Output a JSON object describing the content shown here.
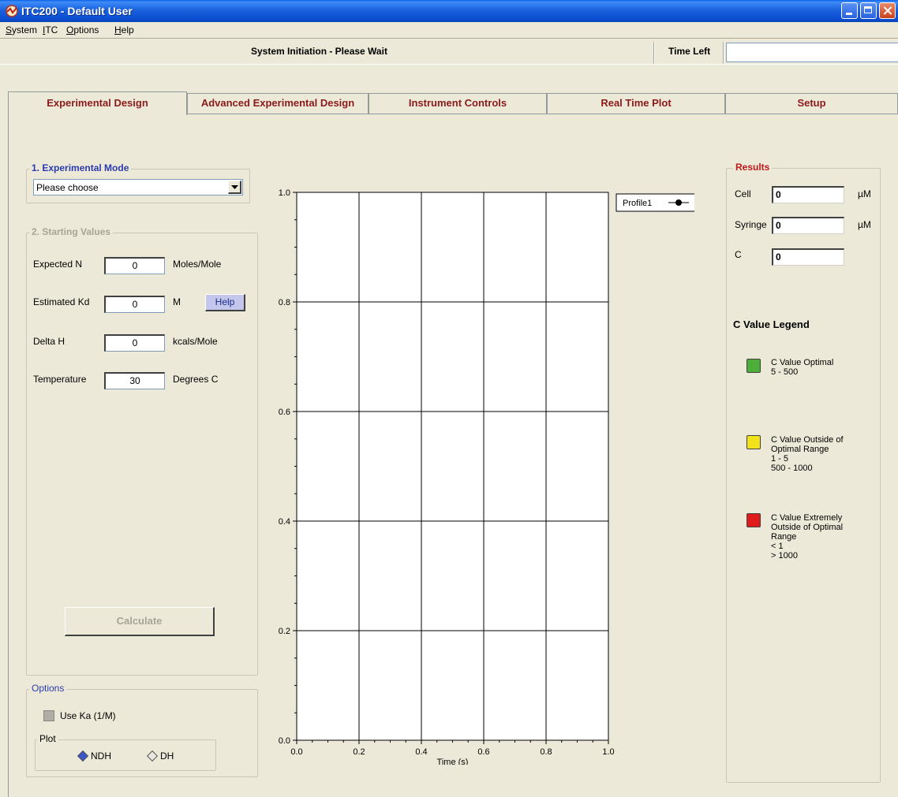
{
  "window": {
    "title": "ITC200 - Default User"
  },
  "menu": {
    "items": [
      {
        "label": "System",
        "mnemonic": "S",
        "rest": "ystem"
      },
      {
        "label": "ITC",
        "mnemonic": "I",
        "rest": "TC"
      },
      {
        "label": "Options",
        "mnemonic": "O",
        "rest": "ptions"
      },
      {
        "label": "Help",
        "mnemonic": "H",
        "rest": "elp"
      }
    ]
  },
  "status": {
    "message": "System Initiation - Please Wait",
    "time_left_label": "Time Left",
    "time_left_value": ""
  },
  "tabs": [
    {
      "label": "Experimental Design",
      "active": true
    },
    {
      "label": "Advanced Experimental Design",
      "active": false
    },
    {
      "label": "Instrument Controls",
      "active": false
    },
    {
      "label": "Real Time Plot",
      "active": false
    },
    {
      "label": "Setup",
      "active": false
    }
  ],
  "experimental_mode": {
    "title": "1. Experimental Mode",
    "selected": "Please choose"
  },
  "starting_values": {
    "title": "2. Starting Values",
    "expected_n": {
      "label": "Expected N",
      "value": "0",
      "unit": "Moles/Mole"
    },
    "estimated_kd": {
      "label": "Estimated  Kd",
      "value": "0",
      "unit": "M",
      "help_label": "Help"
    },
    "delta_h": {
      "label": "Delta H",
      "value": "0",
      "unit": "kcals/Mole"
    },
    "temperature": {
      "label": "Temperature",
      "value": "30",
      "unit": "Degrees C"
    },
    "calculate_label": "Calculate"
  },
  "options": {
    "title": "Options",
    "use_ka_label": "Use Ka (1/M)",
    "plot_title": "Plot",
    "ndh_label": "NDH",
    "dh_label": "DH",
    "selected_plot": "NDH"
  },
  "results": {
    "title": "Results",
    "cell": {
      "label": "Cell",
      "value": "0",
      "unit": "µM"
    },
    "syringe": {
      "label": "Syringe",
      "value": "0",
      "unit": "µM"
    },
    "c": {
      "label": "C",
      "value": "0"
    },
    "legend_title": "C Value Legend",
    "legend": [
      {
        "color": "#4caf3a",
        "lines": [
          "C Value Optimal",
          "5 - 500"
        ]
      },
      {
        "color": "#f2e21a",
        "lines": [
          "C Value Outside of",
          "Optimal Range",
          "1 - 5",
          "500 - 1000"
        ]
      },
      {
        "color": "#e01b1b",
        "lines": [
          "C Value Extremely",
          "Outside of Optimal",
          "Range",
          "< 1",
          "> 1000"
        ]
      }
    ]
  },
  "colors": {
    "tab_text": "#8b1a1a",
    "group_title_blue": "#2a3bb0",
    "results_title_red": "#c01818"
  },
  "chart_data": {
    "type": "line",
    "xlabel": "Time (s)",
    "ylabel": "",
    "xlim": [
      0.0,
      1.0
    ],
    "ylim": [
      0.0,
      1.0
    ],
    "x_ticks": [
      "0.0",
      "0.2",
      "0.4",
      "0.6",
      "0.8",
      "1.0"
    ],
    "y_ticks": [
      "0.0",
      "0.2",
      "0.4",
      "0.6",
      "0.8",
      "1.0"
    ],
    "grid": true,
    "legend_position": "top-right",
    "series": [
      {
        "name": "Profile1",
        "x": [],
        "y": []
      }
    ]
  }
}
